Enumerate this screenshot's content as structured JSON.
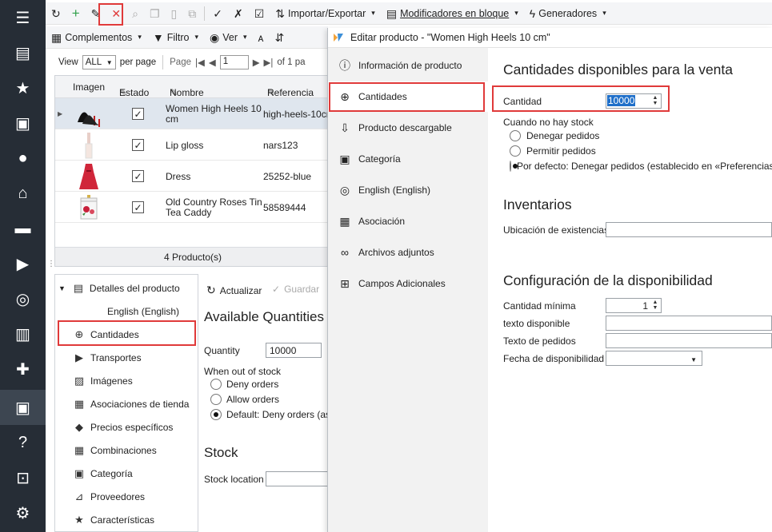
{
  "rail": {
    "items": [
      {
        "icon": "hamburger-icon",
        "glyph": "☰"
      },
      {
        "icon": "store-icon",
        "glyph": "▤"
      },
      {
        "icon": "star-icon",
        "glyph": "★"
      },
      {
        "icon": "inbox-icon",
        "glyph": "▣"
      },
      {
        "icon": "user-icon",
        "glyph": "●"
      },
      {
        "icon": "basket-icon",
        "glyph": "⌂"
      },
      {
        "icon": "comment-icon",
        "glyph": "▬"
      },
      {
        "icon": "truck-icon",
        "glyph": "▶"
      },
      {
        "icon": "globe-icon",
        "glyph": "◎"
      },
      {
        "icon": "chart-icon",
        "glyph": "▥"
      },
      {
        "icon": "puzzle-icon",
        "glyph": "✚"
      },
      {
        "icon": "box-icon",
        "glyph": "▣"
      },
      {
        "icon": "help-icon",
        "glyph": "?"
      },
      {
        "icon": "lock-icon",
        "glyph": "⊡"
      },
      {
        "icon": "settings-icon",
        "glyph": "⚙"
      }
    ]
  },
  "toolbar": {
    "import_export": "Importar/Exportar",
    "bulk_modifiers": "Modificadores en bloque",
    "generators": "Generadores",
    "addons": "Complementos",
    "filter": "Filtro",
    "view_menu": "Ver"
  },
  "pager": {
    "view_label": "View",
    "view_value": "ALL",
    "per_page": "per page",
    "page_label": "Page",
    "page_value": "1",
    "of_label": "of 1 pa"
  },
  "grid": {
    "headers": {
      "image": "Imagen",
      "status": "Estado",
      "name": "Nombre",
      "ref": "Referencia"
    },
    "rows": [
      {
        "name": "Women High Heels 10 cm",
        "ref": "high-heels-10cm",
        "img": "heels"
      },
      {
        "name": "Lip gloss",
        "ref": "nars123",
        "img": "gloss"
      },
      {
        "name": "Dress",
        "ref": "25252-blue",
        "img": "dress"
      },
      {
        "name": "Old Country Roses Tin Tea Caddy",
        "ref": "58589444",
        "img": "caddy"
      }
    ],
    "footer": "4 Producto(s)"
  },
  "tree": {
    "root": "Detalles del producto",
    "child": "English (English)",
    "items": [
      {
        "label": "Cantidades",
        "icon": "quantity-icon"
      },
      {
        "label": "Transportes",
        "icon": "truck-icon"
      },
      {
        "label": "Imágenes",
        "icon": "image-icon"
      },
      {
        "label": "Asociaciones de tienda",
        "icon": "store-link-icon"
      },
      {
        "label": "Precios específicos",
        "icon": "tag-icon"
      },
      {
        "label": "Combinaciones",
        "icon": "grid-icon"
      },
      {
        "label": "Categoría",
        "icon": "folder-icon"
      },
      {
        "label": "Proveedores",
        "icon": "dolly-icon"
      },
      {
        "label": "Características",
        "icon": "star-icon"
      }
    ]
  },
  "detail": {
    "refresh": "Actualizar",
    "save": "Guardar",
    "title": "Available Quantities",
    "quantity_label": "Quantity",
    "quantity_value": "10000",
    "out_of_stock": "When out of stock",
    "deny": "Deny orders",
    "allow": "Allow orders",
    "default": "Default: Deny orders (as",
    "stock_title": "Stock",
    "stock_location": "Stock location"
  },
  "dialog": {
    "title": "Editar producto - \"Women High Heels 10 cm\"",
    "nav": [
      {
        "label": "Información de producto",
        "icon": "info-icon"
      },
      {
        "label": "Cantidades",
        "icon": "quantity-icon"
      },
      {
        "label": "Producto descargable",
        "icon": "download-icon"
      },
      {
        "label": "Categoría",
        "icon": "folder-icon"
      },
      {
        "label": "English (English)",
        "icon": "globe-icon"
      },
      {
        "label": "Asociación",
        "icon": "link-icon"
      },
      {
        "label": "Archivos adjuntos",
        "icon": "paperclip-icon"
      },
      {
        "label": "Campos Adicionales",
        "icon": "fields-icon"
      }
    ],
    "sec1_title": "Cantidades disponibles para la venta",
    "qty_label": "Cantidad",
    "qty_value": "10000",
    "out_label": "Cuando no hay stock",
    "opt_deny": "Denegar pedidos",
    "opt_allow": "Permitir pedidos",
    "opt_default": "Por defecto: Denegar pedidos (establecido en «Preferencias»",
    "sec2_title": "Inventarios",
    "location_label": "Ubicación de existencias",
    "sec3_title": "Configuración de la disponibilidad",
    "min_qty_label": "Cantidad mínima",
    "min_qty_value": "1",
    "avail_text_label": "texto disponible",
    "order_text_label": "Texto de pedidos",
    "avail_date_label": "Fecha de disponibilidad"
  },
  "colors": {
    "accent_red": "#e03a3a",
    "rail": "#262d36",
    "green": "#2fa04a"
  }
}
